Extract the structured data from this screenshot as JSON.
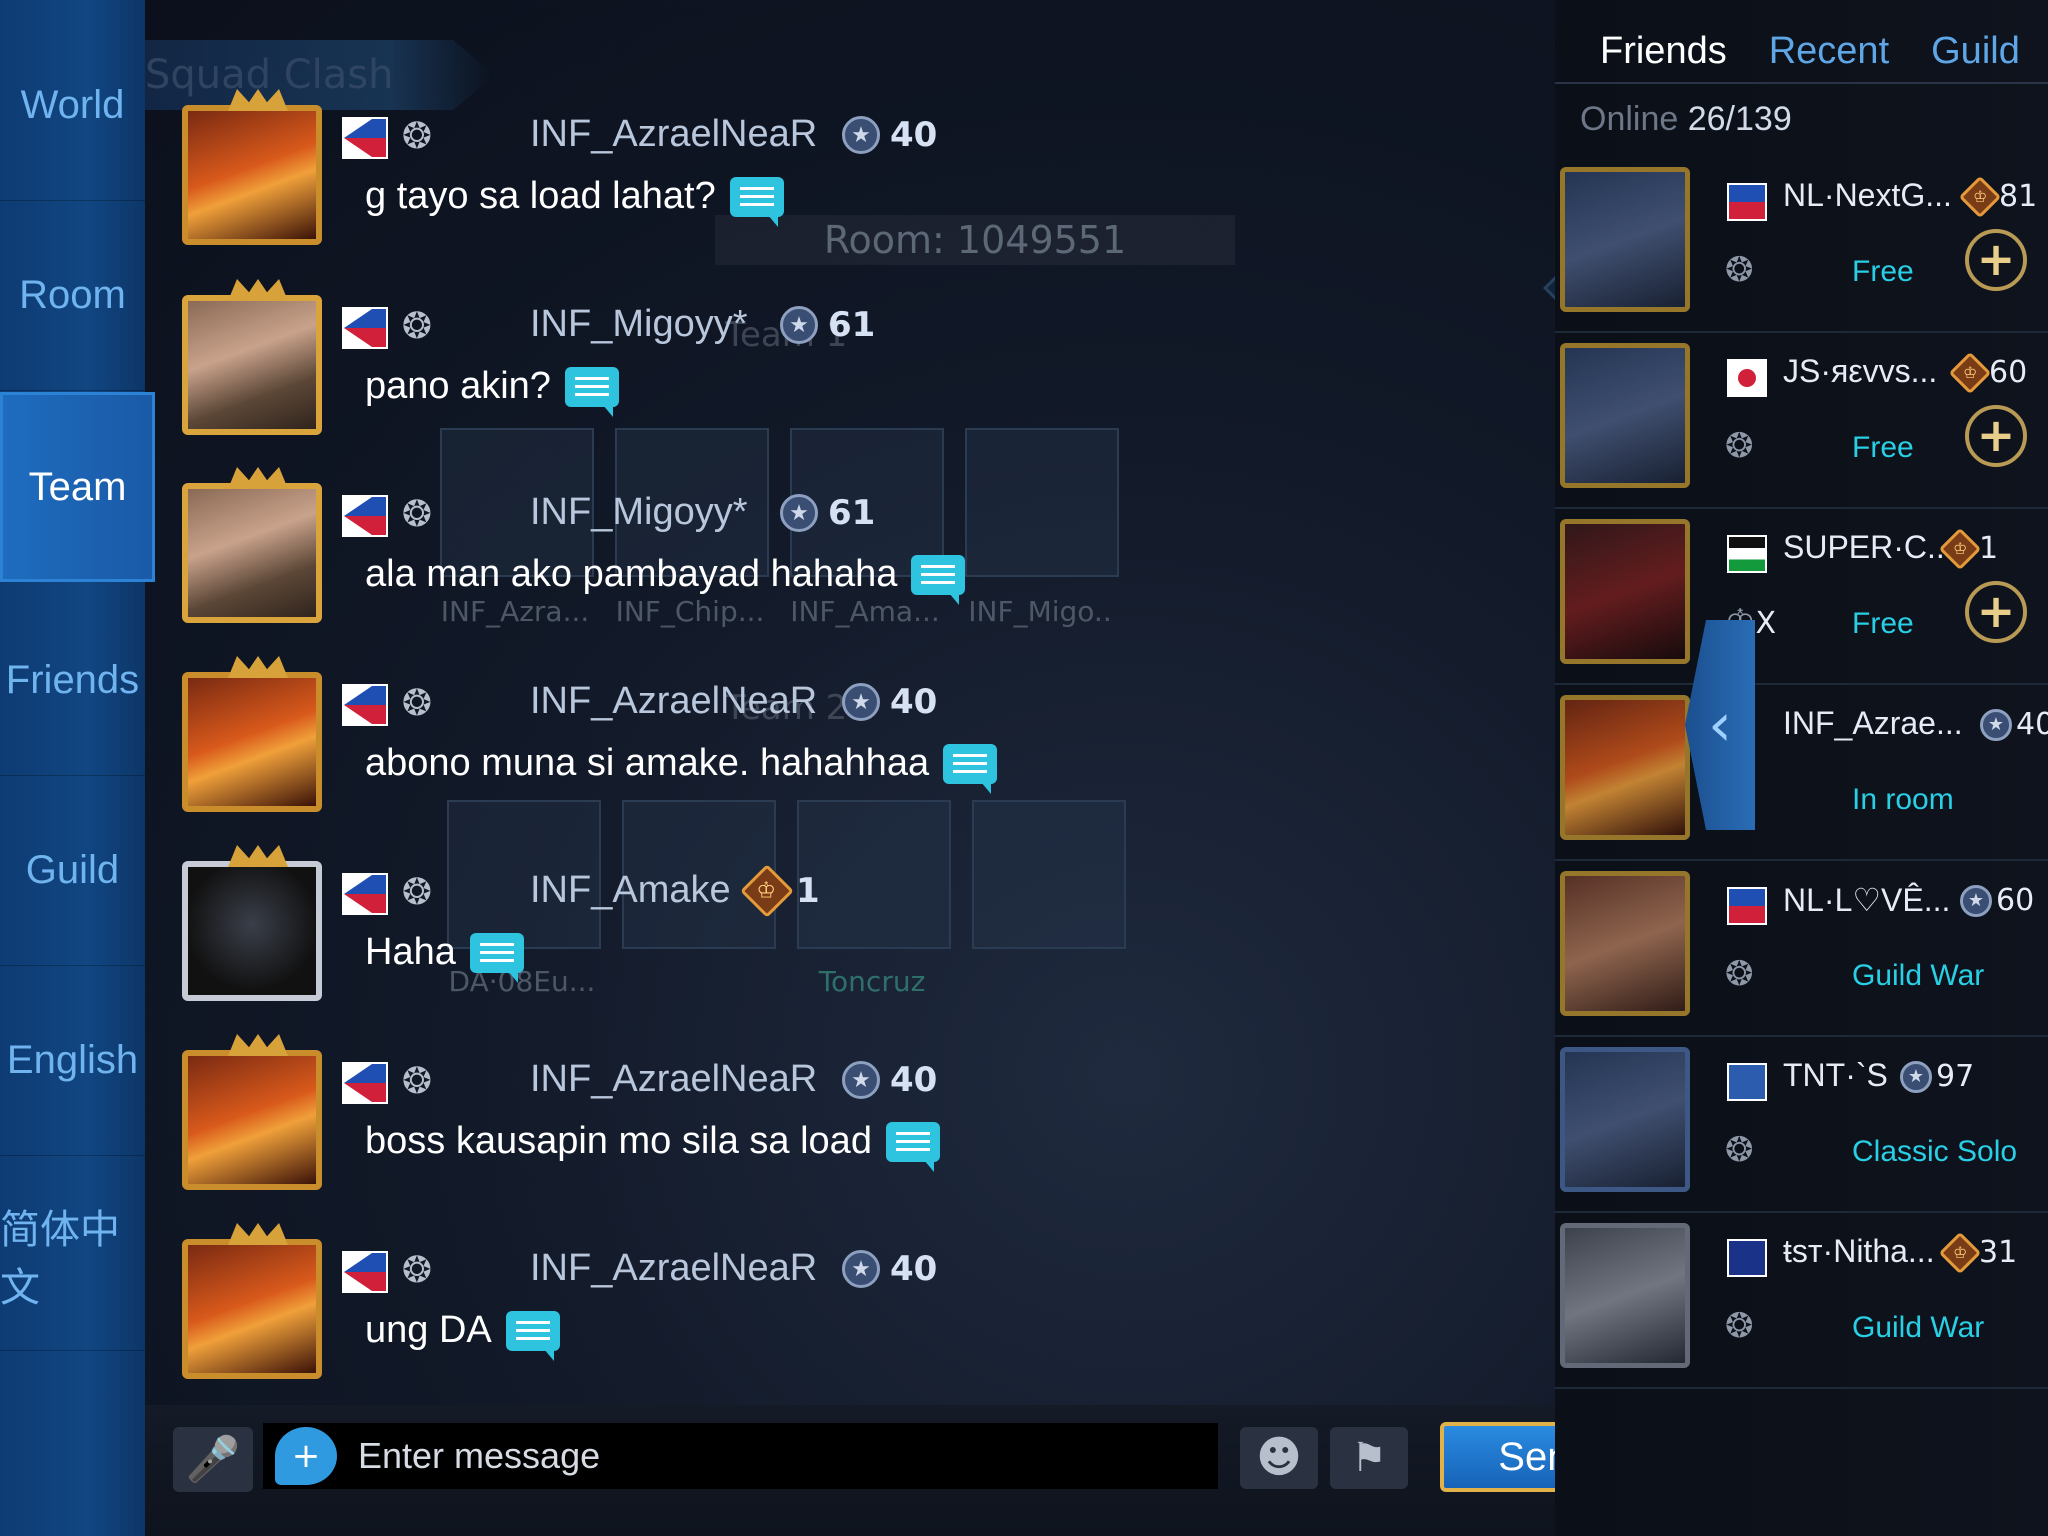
{
  "sidebar": {
    "items": [
      {
        "label": "World"
      },
      {
        "label": "Room"
      },
      {
        "label": "Team"
      },
      {
        "label": "Friends"
      },
      {
        "label": "Guild"
      },
      {
        "label": "English"
      },
      {
        "label": "简体中文"
      }
    ],
    "active": "Team"
  },
  "background": {
    "mode_title": "Squad Clash",
    "room_label": "Room: 1049551",
    "team1_label": "Team 1",
    "team2_label": "Team 2",
    "team1_slots": [
      "INF_Azra...",
      "INF_Chip...",
      "INF_Ama...",
      "INF_Migo.."
    ],
    "team2_slots": [
      "DA·08Eu...",
      "",
      "Toncruz",
      ""
    ]
  },
  "messages": [
    {
      "name": "INF_AzraelNeaR",
      "rank": "40",
      "text": "g tayo sa load lahat?"
    },
    {
      "name": "INF_Migoyy*",
      "rank": "61",
      "text": "pano akin?"
    },
    {
      "name": "INF_Migoyy*",
      "rank": "61",
      "text": "ala man ako pambayad hahaha"
    },
    {
      "name": "INF_AzraelNeaR",
      "rank": "40",
      "text": "abono muna si amake. hahahhaa"
    },
    {
      "name": "INF_Amake",
      "rank": "1",
      "text": "Haha"
    },
    {
      "name": "INF_AzraelNeaR",
      "rank": "40",
      "text": "boss kausapin mo sila sa load"
    },
    {
      "name": "INF_AzraelNeaR",
      "rank": "40",
      "text": "ung DA"
    }
  ],
  "input": {
    "placeholder": "Enter message",
    "send_label": "Send"
  },
  "friends_panel": {
    "tabs": [
      {
        "label": "Friends"
      },
      {
        "label": "Recent"
      },
      {
        "label": "Guild"
      }
    ],
    "online_label": "Online",
    "online_count": "26/139",
    "friends": [
      {
        "name": "NL·NextG...",
        "rank": "81",
        "status": "Free"
      },
      {
        "name": "JS·яεvvs...",
        "rank": "60",
        "status": "Free"
      },
      {
        "name": "SUPER·C...",
        "rank": "1",
        "status": "Free",
        "extra": "X"
      },
      {
        "name": "INF_Azrae...",
        "rank": "40",
        "status": "In room"
      },
      {
        "name": "NL·L♡VÊ...",
        "rank": "60",
        "status": "Guild War"
      },
      {
        "name": "TNT·`S",
        "rank": "97",
        "status": "Classic Solo"
      },
      {
        "name": "ŧsт·Nitha...",
        "rank": "31",
        "status": "Guild War"
      }
    ]
  },
  "colors": {
    "accent_cyan": "#29cfe5",
    "sidebar_blue": "#114682",
    "send_gold": "#e2b24a"
  }
}
